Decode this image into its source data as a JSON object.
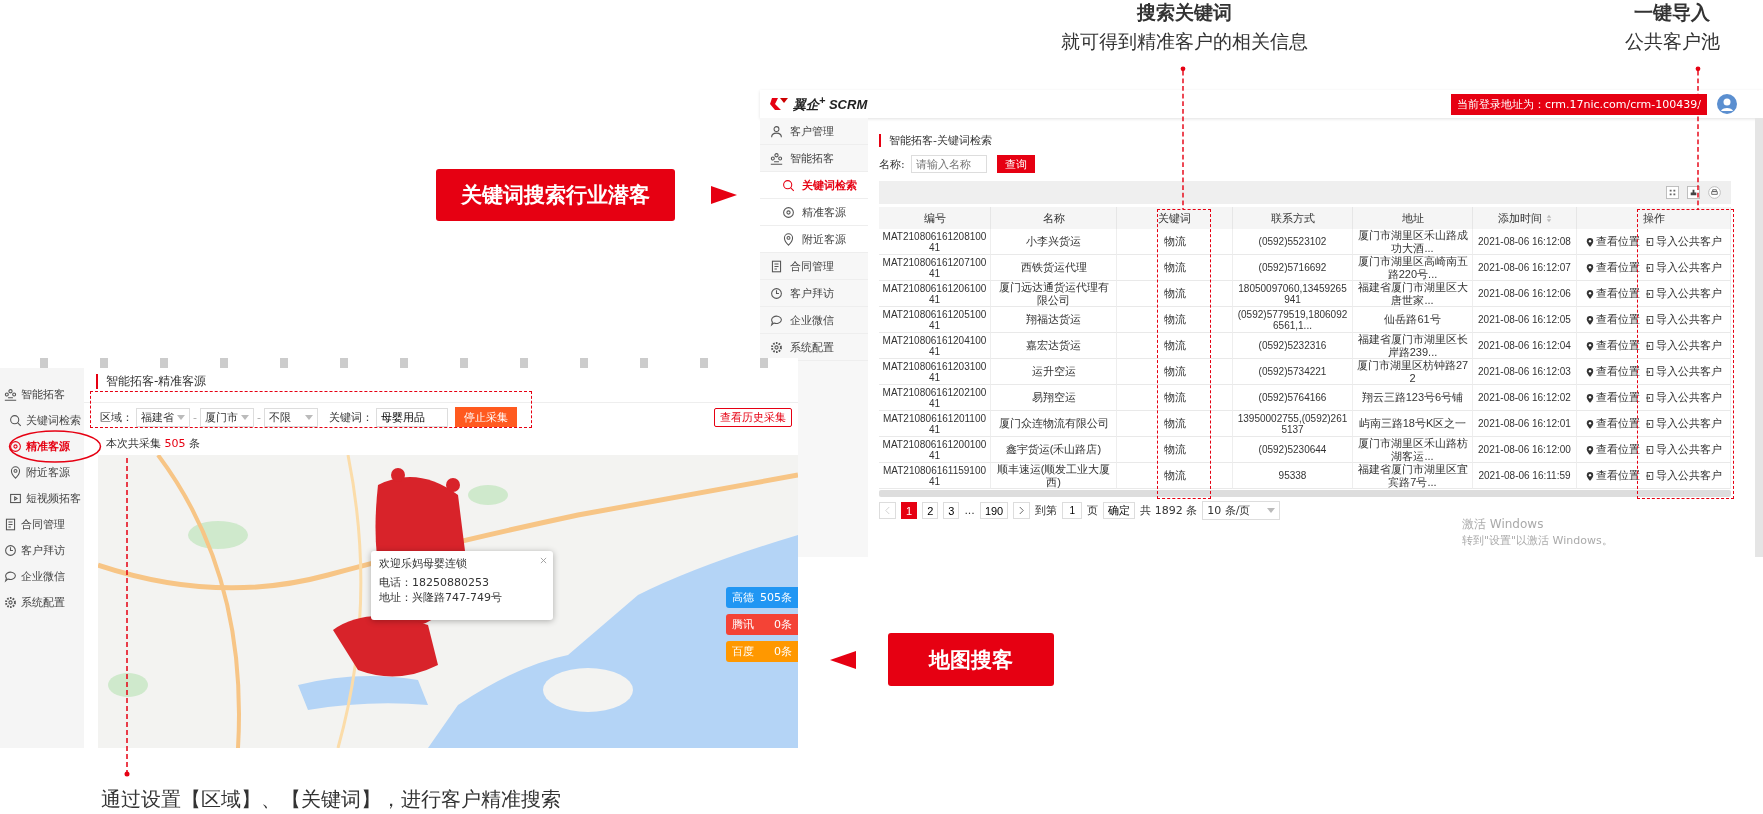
{
  "annotations": {
    "keyword_caption": {
      "title": "搜索关键词",
      "subtitle": "就可得到精准客户的相关信息"
    },
    "import_caption": {
      "title": "一键导入",
      "subtitle": "公共客户池"
    },
    "keyword_callout": "关键词搜索行业潜客",
    "map_callout": "地图搜客",
    "bottom_note": "通过设置【区域】、【关键词】，进行客户精准搜索"
  },
  "keyword_app": {
    "logo": "翼企$^{+}$ SCRM",
    "login_notice": "当前登录地址为：crm.17nic.com/crm-100439/",
    "sidebar": [
      {
        "label": "客户管理",
        "selected": false
      },
      {
        "label": "智能拓客",
        "selected": false,
        "children": [
          {
            "label": "关键词检索",
            "selected": true
          },
          {
            "label": "精准客源",
            "selected": false
          },
          {
            "label": "附近客源",
            "selected": false
          }
        ]
      },
      {
        "label": "合同管理",
        "selected": false
      },
      {
        "label": "客户拜访",
        "selected": false
      },
      {
        "label": "企业微信",
        "selected": false
      },
      {
        "label": "系统配置",
        "selected": false
      }
    ],
    "breadcrumb": "智能拓客-关键词检索",
    "search": {
      "label": "名称:",
      "placeholder": "请输入名称",
      "button": "查询"
    },
    "table": {
      "columns": [
        {
          "label": "编号",
          "sortable": false
        },
        {
          "label": "名称",
          "sortable": false
        },
        {
          "label": "关键词",
          "sortable": false
        },
        {
          "label": "联系方式",
          "sortable": false
        },
        {
          "label": "地址",
          "sortable": false
        },
        {
          "label": "添加时间",
          "sortable": true
        },
        {
          "label": "操作",
          "sortable": false
        }
      ],
      "rows": [
        {
          "cells": [
            "MAT21080616120810041",
            "小李兴货运",
            "物流",
            "(0592)5523102",
            "厦门市湖里区禾山路成功大酒...",
            "2021-08-06 16:12:08"
          ],
          "actions": [
            "查看位置",
            "导入公共客户"
          ]
        },
        {
          "cells": [
            "MAT21080616120710041",
            "西铁货运代理",
            "物流",
            "(0592)5716692",
            "厦门市湖里区高崎南五路220号...",
            "2021-08-06 16:12:07"
          ],
          "actions": [
            "查看位置",
            "导入公共客户"
          ]
        },
        {
          "cells": [
            "MAT21080616120610041",
            "厦门远达通货运代理有限公司",
            "物流",
            "18050097060,13459265941",
            "福建省厦门市湖里区大唐世家...",
            "2021-08-06 16:12:06"
          ],
          "actions": [
            "查看位置",
            "导入公共客户"
          ]
        },
        {
          "cells": [
            "MAT21080616120510041",
            "翔福达货运",
            "物流",
            "(0592)5779519,18060926561,1...",
            "仙岳路61号",
            "2021-08-06 16:12:05"
          ],
          "actions": [
            "查看位置",
            "导入公共客户"
          ]
        },
        {
          "cells": [
            "MAT21080616120410041",
            "嘉宏达货运",
            "物流",
            "(0592)5232316",
            "福建省厦门市湖里区长岸路239...",
            "2021-08-06 16:12:04"
          ],
          "actions": [
            "查看位置",
            "导入公共客户"
          ]
        },
        {
          "cells": [
            "MAT21080616120310041",
            "运升空运",
            "物流",
            "(0592)5734221",
            "厦门市湖里区枋钟路272",
            "2021-08-06 16:12:03"
          ],
          "actions": [
            "查看位置",
            "导入公共客户"
          ]
        },
        {
          "cells": [
            "MAT21080616120210041",
            "易翔空运",
            "物流",
            "(0592)5764166",
            "翔云三路123号6号铺",
            "2021-08-06 16:12:02"
          ],
          "actions": [
            "查看位置",
            "导入公共客户"
          ]
        },
        {
          "cells": [
            "MAT21080616120110041",
            "厦门众连物流有限公司",
            "物流",
            "13950002755,(0592)2615137",
            "屿南三路18号K区之一",
            "2021-08-06 16:12:01"
          ],
          "actions": [
            "查看位置",
            "导入公共客户"
          ]
        },
        {
          "cells": [
            "MAT21080616120010041",
            "鑫宇货运(禾山路店)",
            "物流",
            "(0592)5230644",
            "厦门市湖里区禾山路枋湖客运...",
            "2021-08-06 16:12:00"
          ],
          "actions": [
            "查看位置",
            "导入公共客户"
          ]
        },
        {
          "cells": [
            "MAT21080616115910041",
            "顺丰速运(顺发工业大厦西)",
            "物流",
            "95338",
            "福建省厦门市湖里区宜宾路7号...",
            "2021-08-06 16:11:59"
          ],
          "actions": [
            "查看位置",
            "导入公共客户"
          ]
        }
      ]
    },
    "pagination": {
      "pages": [
        {
          "label": "1",
          "selected": true
        },
        {
          "label": "2",
          "selected": false
        },
        {
          "label": "3",
          "selected": false
        }
      ],
      "ellipsis": "...",
      "last_page": {
        "label": "190",
        "selected": false
      },
      "goto_label": "到第",
      "goto_value": "1",
      "page_unit": "页",
      "confirm": "确定",
      "total": "共 1892 条",
      "page_size": "10 条/页"
    }
  },
  "windows_notice": {
    "title": "激活 Windows",
    "hint": "转到\"设置\"以激活 Windows。"
  },
  "map_app": {
    "sidebar": [
      {
        "label": "智能拓客",
        "selected": false,
        "children": [
          {
            "label": "关键词检索",
            "selected": false
          },
          {
            "label": "精准客源",
            "selected": true
          },
          {
            "label": "附近客源",
            "selected": false
          },
          {
            "label": "短视频拓客",
            "selected": false
          }
        ]
      },
      {
        "label": "合同管理",
        "selected": false
      },
      {
        "label": "客户拜访",
        "selected": false
      },
      {
        "label": "企业微信",
        "selected": false
      },
      {
        "label": "系统配置",
        "selected": false
      }
    ],
    "title": "智能拓客-精准客源",
    "filters": {
      "region_label": "区域：",
      "selects": [
        "福建省",
        "厦门市",
        "不限"
      ],
      "separator": "-",
      "keyword_label": "关键词：",
      "keyword_value": "母婴用品",
      "stop_button": "停止采集"
    },
    "history_button": "查看历史采集",
    "count": {
      "prefix": "本次共采集",
      "value": "505",
      "suffix": "条"
    },
    "map": {
      "kind": "picture",
      "popup": {
        "title": "欢迎乐妈母婴连锁",
        "phone": "电话：18250880253",
        "address": "地址：兴隆路747-749号"
      },
      "sources": [
        {
          "name": "高德",
          "count": "505条",
          "color": "#2196f3"
        },
        {
          "name": "腾讯",
          "count": "0条",
          "color": "#f44336"
        },
        {
          "name": "百度",
          "count": "0条",
          "color": "#ff9800"
        }
      ]
    }
  }
}
